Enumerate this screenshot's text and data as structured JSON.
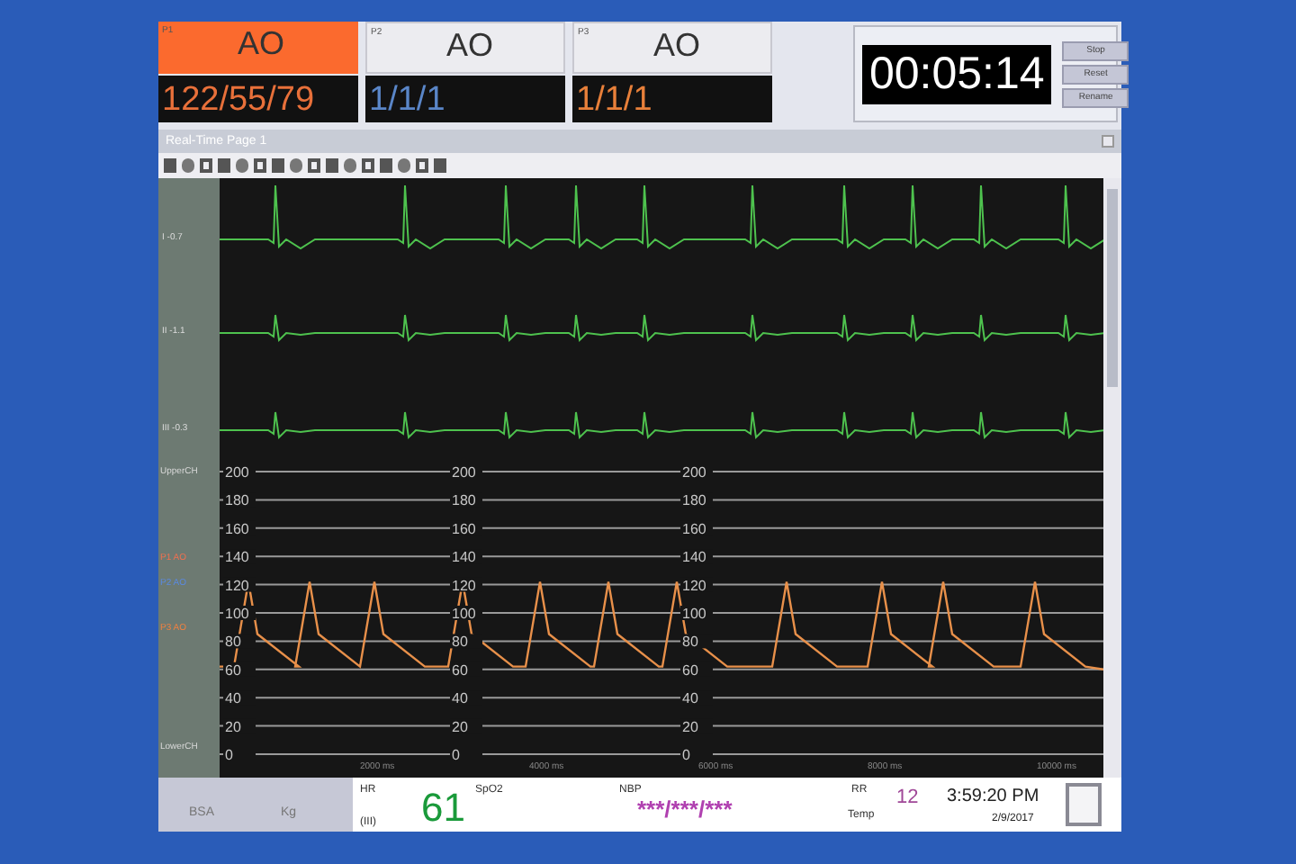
{
  "channels_header": [
    {
      "label": "P1",
      "name": "AO",
      "value": "122/55/79",
      "highlighted": true,
      "color": "#e8703a"
    },
    {
      "label": "P2",
      "name": "AO",
      "value": "1/1/1",
      "highlighted": false,
      "color": "#5a86c8"
    },
    {
      "label": "P3",
      "name": "AO",
      "value": "1/1/1",
      "highlighted": false,
      "color": "#e8803a"
    }
  ],
  "timer": {
    "time": "00:05:14",
    "buttons": [
      "Stop",
      "Reset",
      "Rename"
    ]
  },
  "window": {
    "title": "Real-Time Page 1"
  },
  "ecg_leads": [
    {
      "label": "I -0.7"
    },
    {
      "label": "II -1.1"
    },
    {
      "label": "III -0.3"
    }
  ],
  "pressure_labels": [
    {
      "label": "UpperCH",
      "color": "#d8d8d8"
    },
    {
      "label": "P1 AO",
      "color": "#f07050"
    },
    {
      "label": "P2 AO",
      "color": "#5a8ae0"
    },
    {
      "label": "P3 AO",
      "color": "#f08040"
    },
    {
      "label": "LowerCH",
      "color": "#d8d8d8"
    }
  ],
  "y_axes": [
    {
      "ticks": [
        "200",
        "180",
        "160",
        "140",
        "120",
        "100",
        "80",
        "60",
        "40",
        "20",
        "0"
      ]
    },
    {
      "ticks": [
        "200",
        "180",
        "160",
        "140",
        "120",
        "100",
        "80",
        "60",
        "40",
        "20",
        "0"
      ]
    },
    {
      "ticks": [
        "200",
        "180",
        "160",
        "140",
        "120",
        "100",
        "80",
        "60",
        "40",
        "20",
        "0"
      ]
    }
  ],
  "time_labels": [
    "2000 ms",
    "4000 ms",
    "6000 ms",
    "8000 ms",
    "10000 ms"
  ],
  "status": {
    "bsa": "BSA",
    "kg": "Kg",
    "hr_label": "HR",
    "hr_lead": "(III)",
    "hr": "61",
    "spo2_label": "SpO2",
    "nbp_label": "NBP",
    "nbp": "***/***/***",
    "rr_label": "RR",
    "rr": "12",
    "temp_label": "Temp",
    "clock": "3:59:20 PM",
    "date": "2/9/2017"
  }
}
